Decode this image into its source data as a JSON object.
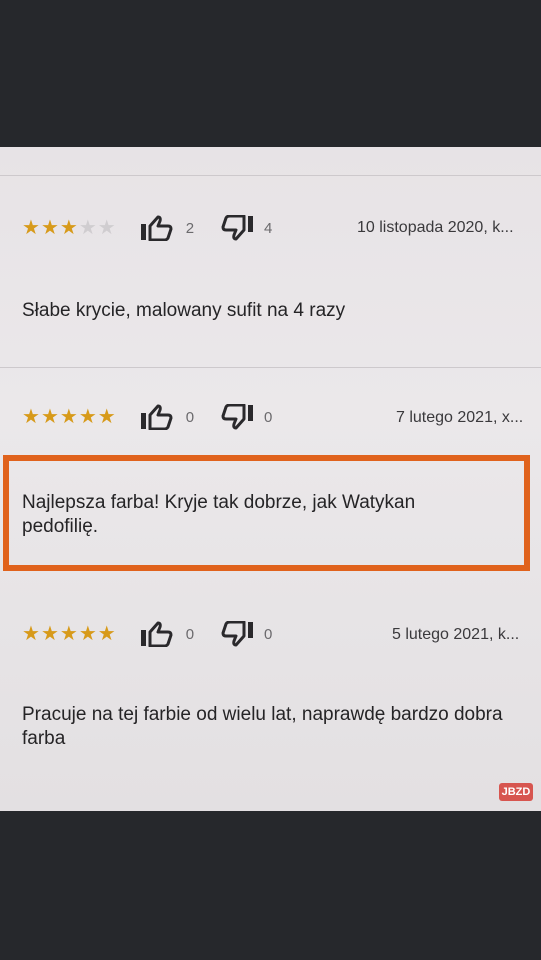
{
  "reviews": [
    {
      "rating": 3,
      "max_rating": 5,
      "likes": "2",
      "dislikes": "4",
      "date": "10 listopada 2020, k...",
      "text": "Słabe krycie, malowany sufit na 4 razy",
      "highlighted": false
    },
    {
      "rating": 5,
      "max_rating": 5,
      "likes": "0",
      "dislikes": "0",
      "date": "7 lutego 2021, x...",
      "text": "Najlepsza farba! Kryje tak dobrze, jak Watykan pedofilię.",
      "highlighted": true
    },
    {
      "rating": 5,
      "max_rating": 5,
      "likes": "0",
      "dislikes": "0",
      "date": "5 lutego 2021, k...",
      "text": "Pracuje na tej farbie od wielu lat, naprawdę bardzo dobra farba",
      "highlighted": false
    }
  ],
  "colors": {
    "star_on": "#d79a1a",
    "star_off": "#d0cdd0",
    "highlight_border": "#e0621c",
    "background": "#26282c"
  },
  "icons": {
    "like": "thumbs-up-icon",
    "dislike": "thumbs-down-icon",
    "star": "star-icon"
  },
  "watermark": "JBZD"
}
